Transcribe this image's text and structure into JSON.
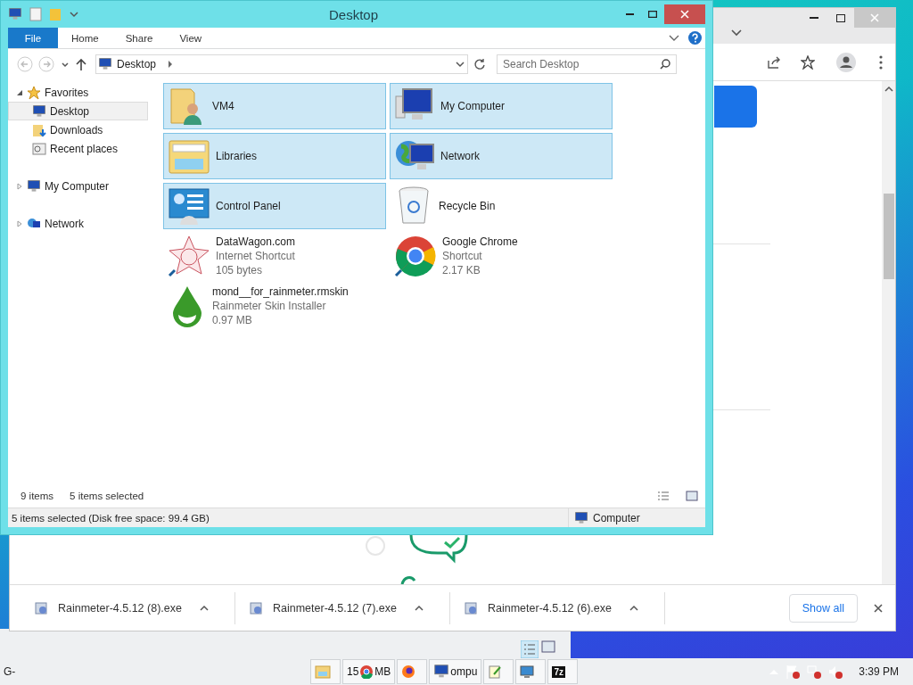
{
  "browser": {
    "downloads": [
      {
        "name": "Rainmeter-4.5.12 (8).exe"
      },
      {
        "name": "Rainmeter-4.5.12 (7).exe"
      },
      {
        "name": "Rainmeter-4.5.12 (6).exe"
      }
    ],
    "show_all": "Show all"
  },
  "explorer": {
    "title": "Desktop",
    "ribbon_tabs": [
      {
        "label": "File",
        "selected": true
      },
      {
        "label": "Home",
        "selected": false
      },
      {
        "label": "Share",
        "selected": false
      },
      {
        "label": "View",
        "selected": false
      }
    ],
    "address": "Desktop",
    "search": {
      "placeholder": "Search Desktop"
    },
    "nav": [
      {
        "label": "Favorites",
        "kind": "star",
        "expanded": true,
        "children": [
          {
            "label": "Desktop",
            "kind": "desktop",
            "selected": true
          },
          {
            "label": "Downloads",
            "kind": "downloads",
            "selected": false
          },
          {
            "label": "Recent places",
            "kind": "recent",
            "selected": false
          }
        ]
      },
      {
        "label": "My Computer",
        "kind": "computer",
        "expanded": false
      },
      {
        "label": "Network",
        "kind": "network",
        "expanded": false
      }
    ],
    "items": [
      {
        "name": "VM4",
        "kind": "user-folder",
        "selected": true
      },
      {
        "name": "My Computer",
        "kind": "computer",
        "selected": true
      },
      {
        "name": "Libraries",
        "kind": "libraries",
        "selected": true
      },
      {
        "name": "Network",
        "kind": "network",
        "selected": true
      },
      {
        "name": "Control Panel",
        "kind": "control-panel",
        "selected": true
      },
      {
        "name": "Recycle Bin",
        "kind": "recycle-bin",
        "selected": false
      },
      {
        "name": "DataWagon.com",
        "type": "Internet Shortcut",
        "size": "105 bytes",
        "kind": "web-shortcut",
        "selected": false
      },
      {
        "name": "Google Chrome",
        "type": "Shortcut",
        "size": "2.17 KB",
        "kind": "chrome",
        "selected": false
      },
      {
        "name": "mond__for_rainmeter.rmskin",
        "type": "Rainmeter Skin Installer",
        "size": "0.97 MB",
        "kind": "drop",
        "selected": false
      }
    ],
    "item_count": "9 items",
    "selected_count": "5 items selected",
    "status": "5 items selected (Disk free space: 99.4 GB)",
    "location": "Computer"
  },
  "taskbar": {
    "start_text": "G-",
    "items": [
      {
        "kind": "explorer"
      },
      {
        "kind": "chrome",
        "label": "15",
        "suffix": "MB"
      },
      {
        "kind": "firefox"
      },
      {
        "kind": "computer",
        "label": "ompu"
      },
      {
        "kind": "notepad"
      },
      {
        "kind": "remote"
      },
      {
        "kind": "sevenzip",
        "label": "7z"
      }
    ],
    "clock": "3:39 PM"
  }
}
